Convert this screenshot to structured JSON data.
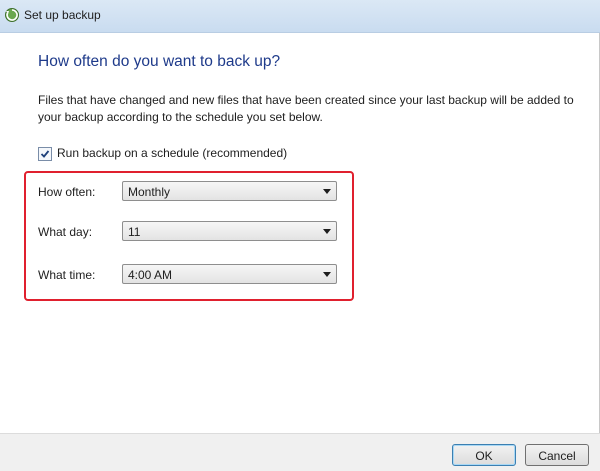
{
  "window": {
    "title": "Set up backup",
    "icon": "backup-app-icon"
  },
  "page": {
    "heading": "How often do you want to back up?",
    "description": "Files that have changed and new files that have been created since your last backup will be added to your backup according to the schedule you set below."
  },
  "schedule": {
    "checkbox_label": "Run backup on a schedule (recommended)",
    "checked": true,
    "fields": {
      "how_often": {
        "label": "How often:",
        "value": "Monthly"
      },
      "what_day": {
        "label": "What day:",
        "value": "11"
      },
      "what_time": {
        "label": "What time:",
        "value": "4:00 AM"
      }
    }
  },
  "buttons": {
    "ok": "OK",
    "cancel": "Cancel"
  },
  "colors": {
    "heading": "#1e3a8a",
    "highlight": "#e0202e",
    "titlebar": "#c9dcf0"
  }
}
